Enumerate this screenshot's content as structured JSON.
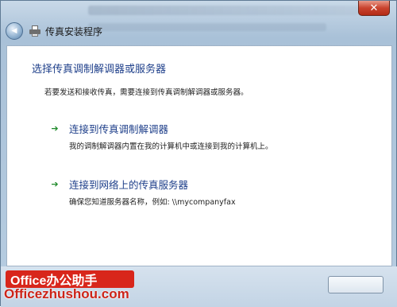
{
  "window": {
    "close_symbol": "✕"
  },
  "nav": {
    "back_symbol": "◀",
    "title": "传真安装程序"
  },
  "main": {
    "heading": "选择传真调制解调器或服务器",
    "instruction": "若要发送和接收传真，需要连接到传真调制解调器或服务器。",
    "options": [
      {
        "title": "连接到传真调制解调器",
        "description": "我的调制解调器内置在我的计算机中或连接到我的计算机上。",
        "icon": "green-arrow-icon"
      },
      {
        "title": "连接到网络上的传真服务器",
        "description": "确保您知道服务器名称，例如: \\\\mycompanyfax",
        "icon": "green-arrow-icon"
      }
    ]
  },
  "watermark": {
    "badge": "Office办公助手",
    "url": "Officezhushou.com"
  },
  "colors": {
    "link_blue": "#1e3f8a",
    "arrow_green": "#1f8a2a",
    "watermark_red": "#d8261b"
  }
}
